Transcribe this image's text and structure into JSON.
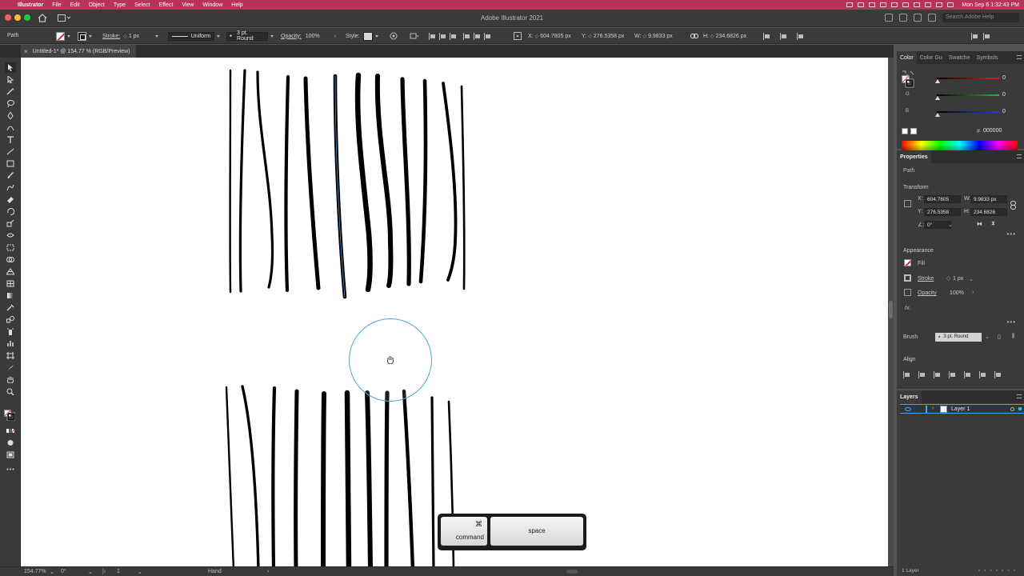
{
  "menubar": {
    "app_name": "Illustrator",
    "items": [
      "File",
      "Edit",
      "Object",
      "Type",
      "Select",
      "Effect",
      "View",
      "Window",
      "Help"
    ],
    "clock": "Mon Sep 6  1:32:43 PM"
  },
  "titlebar": {
    "title": "Adobe Illustrator 2021",
    "search_placeholder": "Search Adobe Help"
  },
  "controlbar": {
    "selection_type": "Path",
    "stroke_label": "Stroke:",
    "stroke_weight": "1 px",
    "profile": "Uniform",
    "brush": "3 pt. Round",
    "opacity_label": "Opacity:",
    "opacity": "100%",
    "style_label": "Style:",
    "x_label": "X:",
    "x": "604.7805 px",
    "y_label": "Y:",
    "y": "276.5358 px",
    "w_label": "W:",
    "w": "9.9833 px",
    "h_label": "H:",
    "h": "234.6826 px"
  },
  "document": {
    "tab_title": "Untitled-1* @ 154.77 % (RGB/Preview)"
  },
  "keycast": {
    "command_glyph": "⌘",
    "command_label": "command",
    "space_label": "space"
  },
  "statusbar": {
    "zoom": "154.77%",
    "rotation": "0°",
    "artboard": "1",
    "tool": "Hand"
  },
  "color_panel": {
    "tabs": [
      "Color",
      "Color Gu",
      "Swatche",
      "Symbols"
    ],
    "channels": [
      {
        "name": "R",
        "value": "0",
        "color": "#e02020"
      },
      {
        "name": "G",
        "value": "0",
        "color": "#20c020"
      },
      {
        "name": "B",
        "value": "0",
        "color": "#2040e0"
      }
    ],
    "hex": "000000"
  },
  "properties_panel": {
    "title": "Properties",
    "object_type": "Path",
    "transform_title": "Transform",
    "x_label": "X:",
    "x": "604.7805",
    "y_label": "Y:",
    "y": "276.5358",
    "w_label": "W:",
    "w": "9.9833 px",
    "h_label": "H:",
    "h": "234.6826",
    "angle_label": "∠:",
    "angle": "0°",
    "appearance_title": "Appearance",
    "fill_label": "Fill",
    "stroke_label": "Stroke",
    "stroke_weight": "1 px",
    "opacity_label": "Opacity",
    "opacity": "100%",
    "fx_label": "fx.",
    "brush_label": "Brush",
    "brush_value": "3 pt. Round",
    "align_title": "Align"
  },
  "layers_panel": {
    "title": "Layers",
    "layer_name": "Layer 1",
    "footer_count": "1 Layer"
  },
  "colors": {
    "menubar_bg": "#b8335a",
    "highlight_blue": "#4aa3ff",
    "hand_ring": "#4da7d7"
  }
}
